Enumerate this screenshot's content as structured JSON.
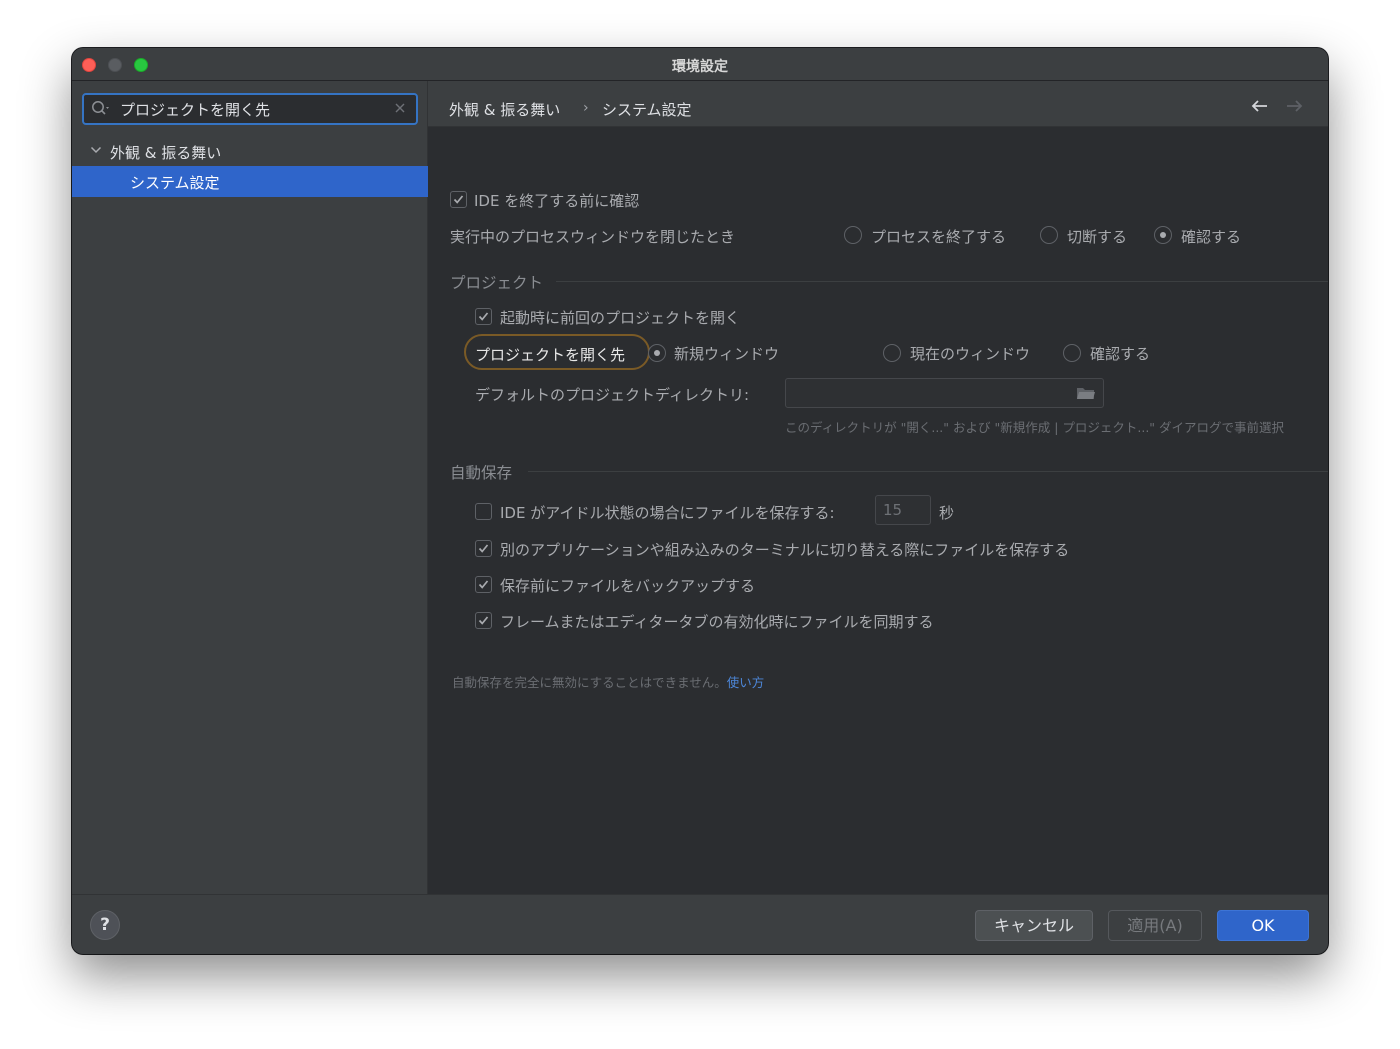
{
  "window": {
    "title": "環境設定"
  },
  "sidebar": {
    "search_value": "プロジェクトを開く先",
    "tree_parent": "外観 & 振る舞い",
    "tree_child": "システム設定"
  },
  "breadcrumb": {
    "parent": "外観 & 振る舞い",
    "separator": "›",
    "current": "システム設定"
  },
  "settings": {
    "confirm_exit": {
      "label": "IDE を終了する前に確認",
      "checked": true
    },
    "process_close": {
      "label": "実行中のプロセスウィンドウを閉じたとき",
      "options": [
        "プロセスを終了する",
        "切断する",
        "確認する"
      ],
      "selected": "確認する"
    },
    "project_section": "プロジェクト",
    "reopen_last": {
      "label": "起動時に前回のプロジェクトを開く",
      "checked": true
    },
    "open_project_in": {
      "label": "プロジェクトを開く先",
      "options": [
        "新規ウィンドウ",
        "現在のウィンドウ",
        "確認する"
      ],
      "selected": "新規ウィンドウ"
    },
    "default_dir": {
      "label": "デフォルトのプロジェクトディレクトリ:",
      "value": "",
      "hint": "このディレクトリが \"開く...\" および \"新規作成 | プロジェクト...\" ダイアログで事前選択"
    },
    "autosave_section": "自動保存",
    "save_idle": {
      "label": "IDE がアイドル状態の場合にファイルを保存する:",
      "checked": false,
      "seconds": "15",
      "unit": "秒"
    },
    "save_on_switch": {
      "label": "別のアプリケーションや組み込みのターミナルに切り替える際にファイルを保存する",
      "checked": true
    },
    "backup": {
      "label": "保存前にファイルをバックアップする",
      "checked": true
    },
    "sync_on_activation": {
      "label": "フレームまたはエディタータブの有効化時にファイルを同期する",
      "checked": true
    },
    "autosave_note": "自動保存を完全に無効にすることはできません。",
    "autosave_link": "使い方"
  },
  "footer": {
    "help_label": "?",
    "cancel_label": "キャンセル",
    "apply_label": "適用(A)",
    "ok_label": "OK"
  },
  "colors": {
    "accent": "#2f65ca",
    "highlight_ring": "#7a5a26",
    "link": "#4d87d9"
  }
}
